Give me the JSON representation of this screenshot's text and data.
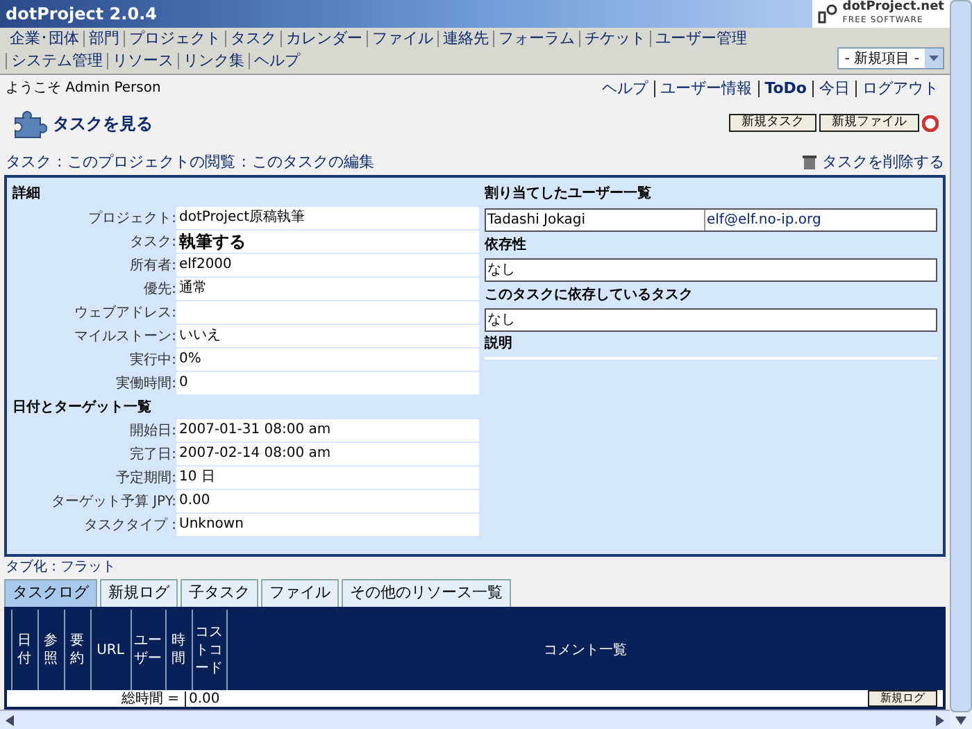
{
  "app_title": "dotProject 2.0.4",
  "logo": {
    "name": "dotProject.net",
    "tagline": "FREE SOFTWARE"
  },
  "nav": [
    "企業･団体",
    "部門",
    "プロジェクト",
    "タスク",
    "カレンダー",
    "ファイル",
    "連絡先",
    "フォーラム",
    "チケット",
    "ユーザー管理",
    "システム管理",
    "リソース",
    "リンク集",
    "ヘルプ"
  ],
  "new_item_select": {
    "value": "- 新規項目 -"
  },
  "welcome": "ようこそ Admin Person",
  "user_links": [
    {
      "label": "ヘルプ",
      "bold": false
    },
    {
      "label": "ユーザー情報",
      "bold": false
    },
    {
      "label": "ToDo",
      "bold": true
    },
    {
      "label": "今日",
      "bold": false
    },
    {
      "label": "ログアウト",
      "bold": false
    }
  ],
  "page_title": "タスクを見る",
  "header_buttons": [
    "新規タスク",
    "新規ファイル"
  ],
  "breadcrumbs": [
    "タスク",
    "このプロジェクトの閲覧",
    "このタスクの編集"
  ],
  "breadcrumb_separator": ":",
  "delete_link": "タスクを削除する",
  "details": {
    "title": "詳細",
    "rows": [
      {
        "label": "プロジェクト:",
        "value": "dotProject原稿執筆",
        "bold": false
      },
      {
        "label": "タスク:",
        "value": "執筆する",
        "bold": true
      },
      {
        "label": "所有者:",
        "value": "elf2000",
        "bold": false
      },
      {
        "label": "優先:",
        "value": "通常",
        "bold": false
      },
      {
        "label": "ウェブアドレス:"
      },
      {
        "label": "マイルストーン:",
        "value": "いいえ",
        "bold": false
      },
      {
        "label": "実行中:",
        "value": "0%",
        "bold": false
      },
      {
        "label": "実働時間:",
        "value": "0",
        "bold": false
      }
    ]
  },
  "dates": {
    "title": "日付とターゲット一覧",
    "rows": [
      {
        "label": "開始日:",
        "value": "2007-01-31 08:00 am"
      },
      {
        "label": "完了日:",
        "value": "2007-02-14 08:00 am"
      },
      {
        "label": "予定期間:",
        "value": "10 日"
      },
      {
        "label": "ターゲット予算 JPY:",
        "value": "0.00"
      },
      {
        "label": "タスクタイプ :",
        "value": "Unknown"
      }
    ]
  },
  "assigned": {
    "title": "割り当てしたユーザー一覧",
    "users": [
      {
        "name": "Tadashi Jokagi",
        "email": "elf@elf.no-ip.org"
      }
    ]
  },
  "dependencies": {
    "title": "依存性",
    "value": "なし"
  },
  "dependents": {
    "title": "このタスクに依存しているタスク",
    "value": "なし"
  },
  "description": {
    "title": "説明"
  },
  "tab_mode": "タブ化 : フラット",
  "tabs": [
    {
      "label": "タスクログ",
      "selected": true
    },
    {
      "label": "新規ログ",
      "selected": false
    },
    {
      "label": "子タスク",
      "selected": false
    },
    {
      "label": "ファイル",
      "selected": false
    },
    {
      "label": "その他のリソース一覧",
      "selected": false
    }
  ],
  "log_table": {
    "columns": [
      {
        "label": "日付",
        "kind": "vertical"
      },
      {
        "label": "参照",
        "kind": "vertical"
      },
      {
        "label": "要約",
        "kind": "vertical"
      },
      {
        "label": "URL",
        "kind": "plain"
      },
      {
        "label": "ユーザー",
        "kind": "pair"
      },
      {
        "label": "時間",
        "kind": "vertical"
      },
      {
        "label": "コストコード",
        "kind": "pair"
      },
      {
        "label": "コメント一覧",
        "kind": "wide"
      }
    ],
    "total_label": "総時間 =",
    "total_value": "0.00",
    "new_log_button": "新規ログ"
  }
}
